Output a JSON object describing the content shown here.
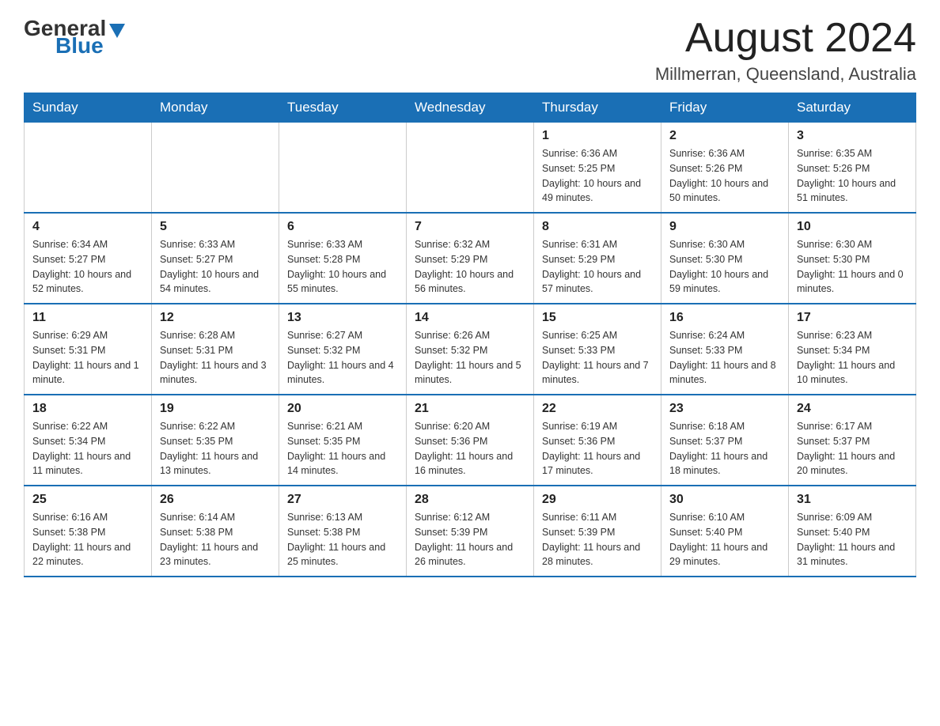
{
  "logo": {
    "general": "General",
    "blue": "Blue"
  },
  "header": {
    "month": "August 2024",
    "location": "Millmerran, Queensland, Australia"
  },
  "days_of_week": [
    "Sunday",
    "Monday",
    "Tuesday",
    "Wednesday",
    "Thursday",
    "Friday",
    "Saturday"
  ],
  "weeks": [
    [
      {
        "day": "",
        "info": ""
      },
      {
        "day": "",
        "info": ""
      },
      {
        "day": "",
        "info": ""
      },
      {
        "day": "",
        "info": ""
      },
      {
        "day": "1",
        "info": "Sunrise: 6:36 AM\nSunset: 5:25 PM\nDaylight: 10 hours and 49 minutes."
      },
      {
        "day": "2",
        "info": "Sunrise: 6:36 AM\nSunset: 5:26 PM\nDaylight: 10 hours and 50 minutes."
      },
      {
        "day": "3",
        "info": "Sunrise: 6:35 AM\nSunset: 5:26 PM\nDaylight: 10 hours and 51 minutes."
      }
    ],
    [
      {
        "day": "4",
        "info": "Sunrise: 6:34 AM\nSunset: 5:27 PM\nDaylight: 10 hours and 52 minutes."
      },
      {
        "day": "5",
        "info": "Sunrise: 6:33 AM\nSunset: 5:27 PM\nDaylight: 10 hours and 54 minutes."
      },
      {
        "day": "6",
        "info": "Sunrise: 6:33 AM\nSunset: 5:28 PM\nDaylight: 10 hours and 55 minutes."
      },
      {
        "day": "7",
        "info": "Sunrise: 6:32 AM\nSunset: 5:29 PM\nDaylight: 10 hours and 56 minutes."
      },
      {
        "day": "8",
        "info": "Sunrise: 6:31 AM\nSunset: 5:29 PM\nDaylight: 10 hours and 57 minutes."
      },
      {
        "day": "9",
        "info": "Sunrise: 6:30 AM\nSunset: 5:30 PM\nDaylight: 10 hours and 59 minutes."
      },
      {
        "day": "10",
        "info": "Sunrise: 6:30 AM\nSunset: 5:30 PM\nDaylight: 11 hours and 0 minutes."
      }
    ],
    [
      {
        "day": "11",
        "info": "Sunrise: 6:29 AM\nSunset: 5:31 PM\nDaylight: 11 hours and 1 minute."
      },
      {
        "day": "12",
        "info": "Sunrise: 6:28 AM\nSunset: 5:31 PM\nDaylight: 11 hours and 3 minutes."
      },
      {
        "day": "13",
        "info": "Sunrise: 6:27 AM\nSunset: 5:32 PM\nDaylight: 11 hours and 4 minutes."
      },
      {
        "day": "14",
        "info": "Sunrise: 6:26 AM\nSunset: 5:32 PM\nDaylight: 11 hours and 5 minutes."
      },
      {
        "day": "15",
        "info": "Sunrise: 6:25 AM\nSunset: 5:33 PM\nDaylight: 11 hours and 7 minutes."
      },
      {
        "day": "16",
        "info": "Sunrise: 6:24 AM\nSunset: 5:33 PM\nDaylight: 11 hours and 8 minutes."
      },
      {
        "day": "17",
        "info": "Sunrise: 6:23 AM\nSunset: 5:34 PM\nDaylight: 11 hours and 10 minutes."
      }
    ],
    [
      {
        "day": "18",
        "info": "Sunrise: 6:22 AM\nSunset: 5:34 PM\nDaylight: 11 hours and 11 minutes."
      },
      {
        "day": "19",
        "info": "Sunrise: 6:22 AM\nSunset: 5:35 PM\nDaylight: 11 hours and 13 minutes."
      },
      {
        "day": "20",
        "info": "Sunrise: 6:21 AM\nSunset: 5:35 PM\nDaylight: 11 hours and 14 minutes."
      },
      {
        "day": "21",
        "info": "Sunrise: 6:20 AM\nSunset: 5:36 PM\nDaylight: 11 hours and 16 minutes."
      },
      {
        "day": "22",
        "info": "Sunrise: 6:19 AM\nSunset: 5:36 PM\nDaylight: 11 hours and 17 minutes."
      },
      {
        "day": "23",
        "info": "Sunrise: 6:18 AM\nSunset: 5:37 PM\nDaylight: 11 hours and 18 minutes."
      },
      {
        "day": "24",
        "info": "Sunrise: 6:17 AM\nSunset: 5:37 PM\nDaylight: 11 hours and 20 minutes."
      }
    ],
    [
      {
        "day": "25",
        "info": "Sunrise: 6:16 AM\nSunset: 5:38 PM\nDaylight: 11 hours and 22 minutes."
      },
      {
        "day": "26",
        "info": "Sunrise: 6:14 AM\nSunset: 5:38 PM\nDaylight: 11 hours and 23 minutes."
      },
      {
        "day": "27",
        "info": "Sunrise: 6:13 AM\nSunset: 5:38 PM\nDaylight: 11 hours and 25 minutes."
      },
      {
        "day": "28",
        "info": "Sunrise: 6:12 AM\nSunset: 5:39 PM\nDaylight: 11 hours and 26 minutes."
      },
      {
        "day": "29",
        "info": "Sunrise: 6:11 AM\nSunset: 5:39 PM\nDaylight: 11 hours and 28 minutes."
      },
      {
        "day": "30",
        "info": "Sunrise: 6:10 AM\nSunset: 5:40 PM\nDaylight: 11 hours and 29 minutes."
      },
      {
        "day": "31",
        "info": "Sunrise: 6:09 AM\nSunset: 5:40 PM\nDaylight: 11 hours and 31 minutes."
      }
    ]
  ]
}
